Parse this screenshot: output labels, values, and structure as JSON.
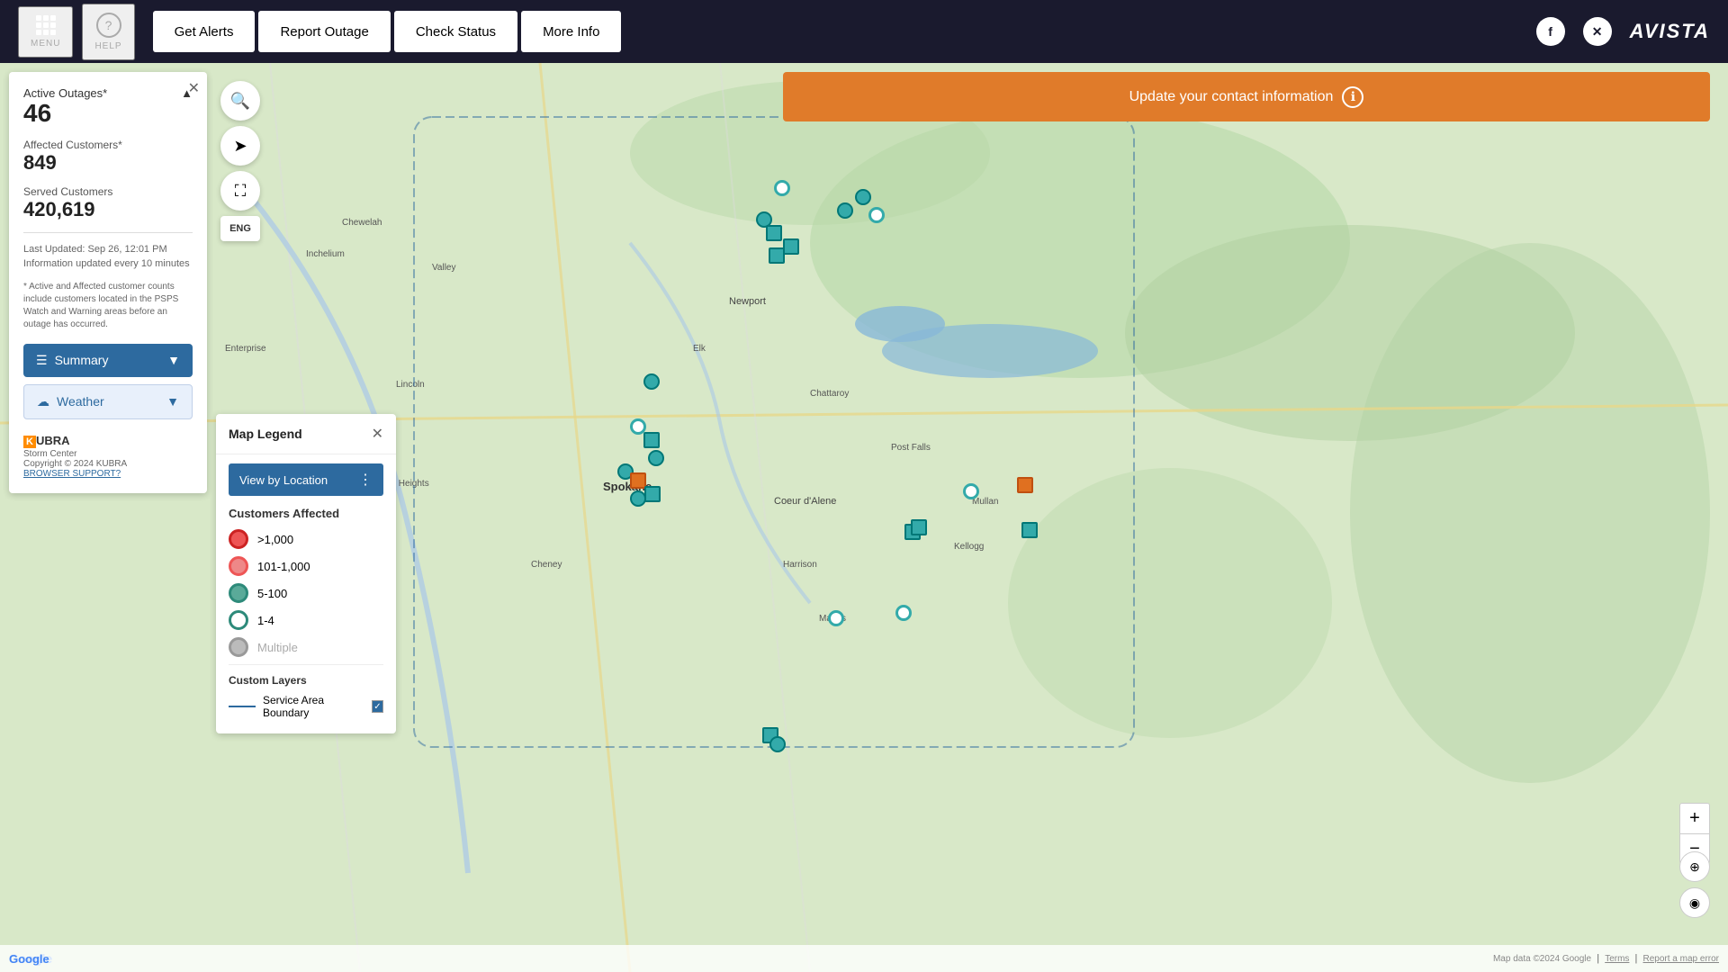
{
  "header": {
    "menu_label": "MENU",
    "help_label": "HELP",
    "get_alerts_label": "Get Alerts",
    "report_outage_label": "Report Outage",
    "check_status_label": "Check Status",
    "more_info_label": "More Info",
    "logo_text": "AVISTA"
  },
  "notification": {
    "text": "Update your contact information",
    "icon": "ℹ"
  },
  "sidebar": {
    "active_outages_label": "Active Outages*",
    "active_outages_count": "46",
    "affected_customers_label": "Affected Customers*",
    "affected_customers_count": "849",
    "served_customers_label": "Served Customers",
    "served_customers_count": "420,619",
    "last_updated": "Last Updated: Sep 26, 12:01 PM",
    "update_interval": "Information updated every 10 minutes",
    "disclaimer": "* Active and Affected customer counts include customers located in the PSPS Watch and Warning areas before an outage has occurred.",
    "summary_label": "Summary",
    "weather_label": "Weather",
    "kubra_label": "KUBRA",
    "storm_center_label": "Storm Center",
    "copyright": "Copyright © 2024 KUBRA",
    "browser_support": "BROWSER SUPPORT?"
  },
  "legend": {
    "title": "Map Legend",
    "view_by_location_label": "View by Location",
    "customers_affected_label": "Customers Affected",
    "items": [
      {
        "label": ">1,000",
        "type": "dot-red"
      },
      {
        "label": "101-1,000",
        "type": "dot-orange"
      },
      {
        "label": "5-100",
        "type": "dot-teal"
      },
      {
        "label": "1-4",
        "type": "dot-teal-outline"
      },
      {
        "label": "Multiple",
        "type": "dot-grey"
      }
    ],
    "custom_layers_label": "Custom Layers",
    "service_area_label": "Service Area Boundary",
    "service_area_checked": true
  },
  "map": {
    "places": [
      "Newport",
      "Spokane",
      "Coeur d'Alene"
    ],
    "zoom_in": "+",
    "zoom_out": "−",
    "attribution": "Map data ©2024 Google",
    "terms": "Terms",
    "report_error": "Report a map error"
  }
}
